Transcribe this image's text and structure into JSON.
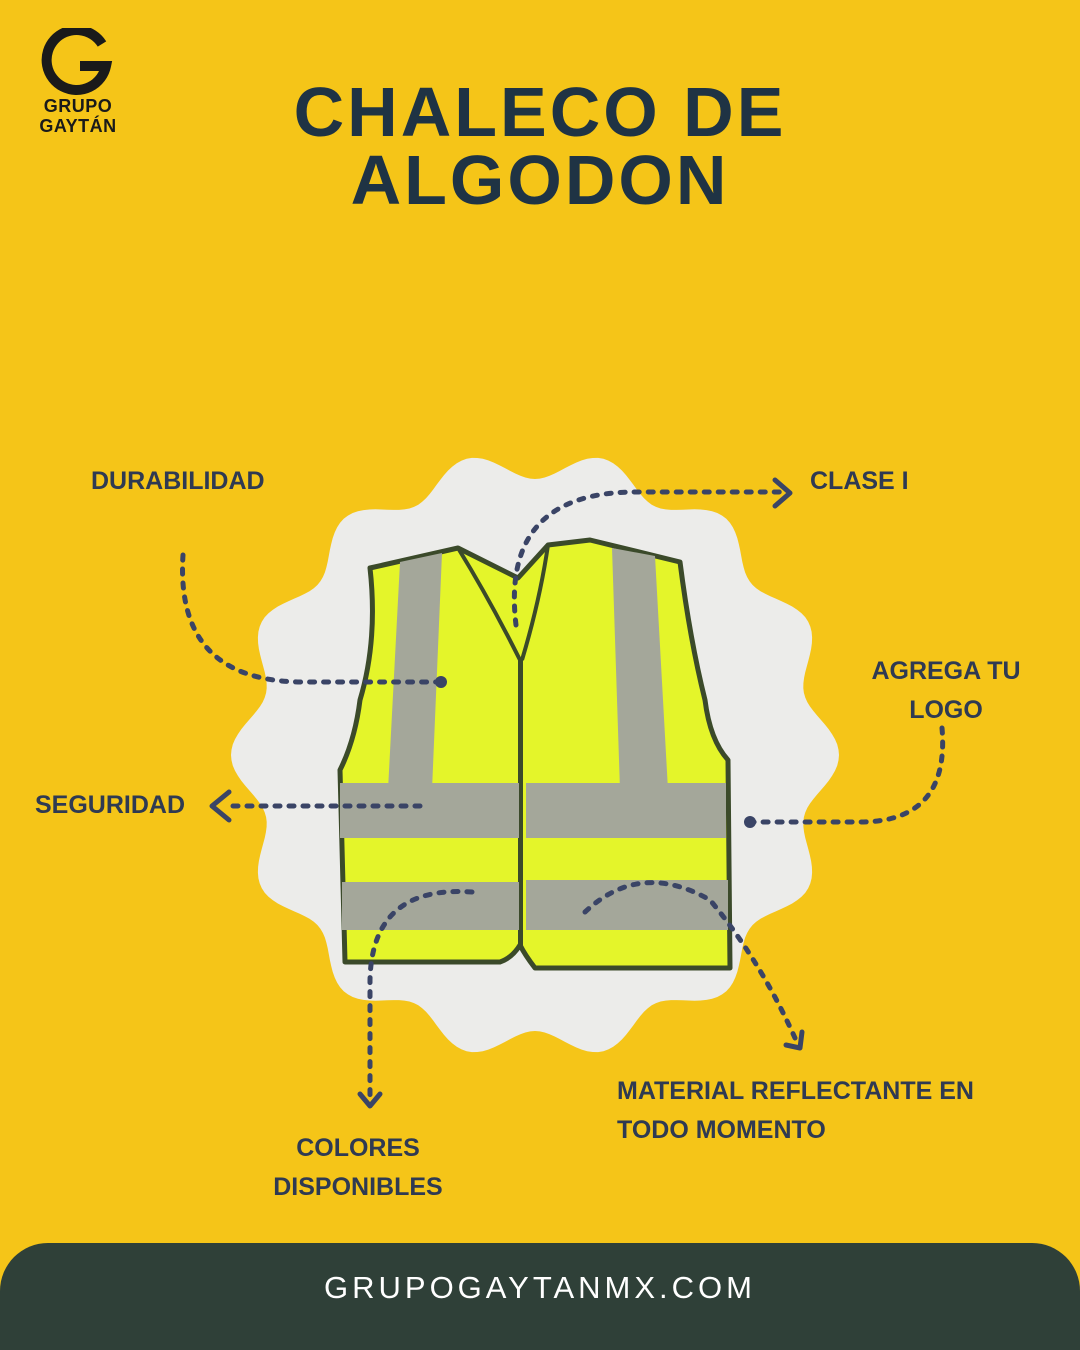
{
  "brand": {
    "logo_letter": "G",
    "line1": "GRUPO",
    "line2": "GAYTÁN"
  },
  "title": {
    "line1": "CHALECO DE",
    "line2": "ALGODON"
  },
  "features": {
    "durabilidad": "DURABILIDAD",
    "clase": "CLASE I",
    "agrega_line1": "AGREGA TU",
    "agrega_line2": "LOGO",
    "seguridad": "SEGURIDAD",
    "material_line1": "MATERIAL REFLECTANTE EN",
    "material_line2": "TODO MOMENTO",
    "colores_line1": "COLORES",
    "colores_line2": "DISPONIBLES"
  },
  "footer": {
    "url": "GRUPOGAYTANMX.COM"
  },
  "colors": {
    "background": "#F5C518",
    "title": "#1F3344",
    "label": "#2F3A52",
    "dotted_line": "#3A4466",
    "footer_bg": "#2F4038",
    "vest_yellow": "#E4F52A",
    "reflective_gray": "#A4A79A"
  }
}
